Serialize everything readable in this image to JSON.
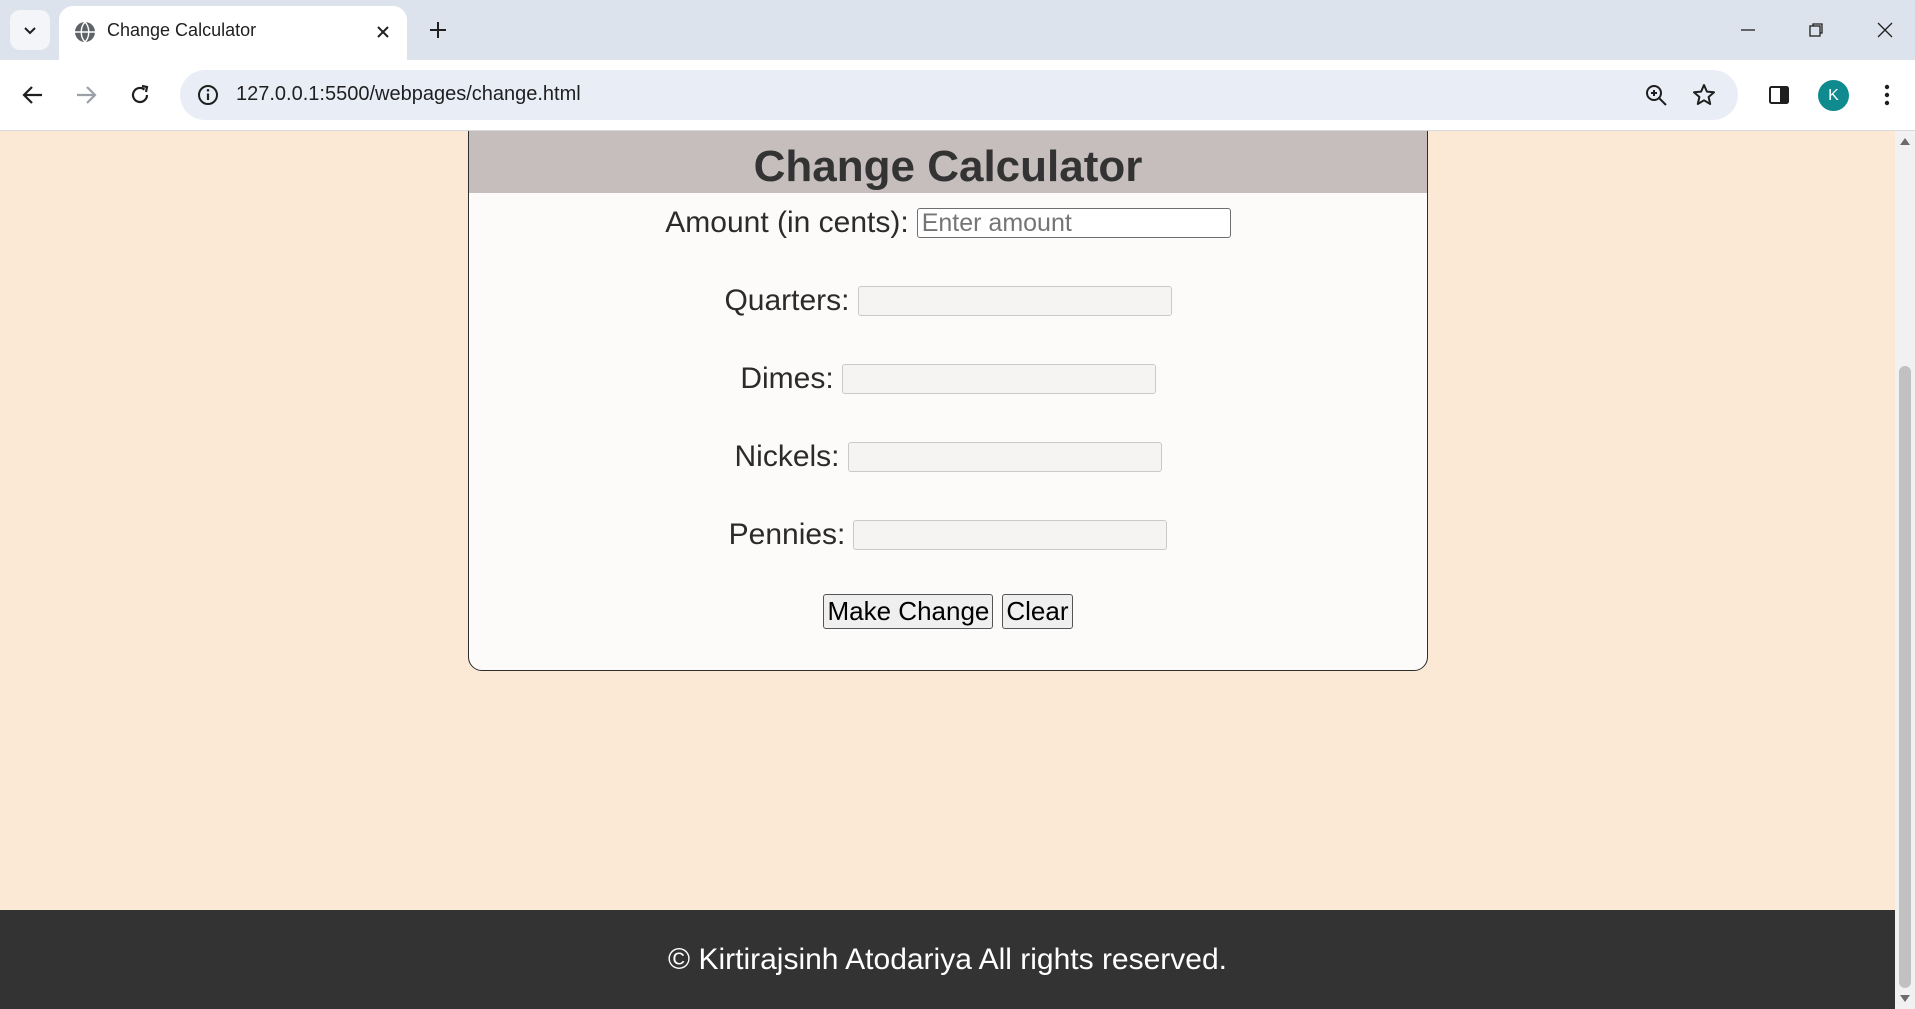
{
  "browser": {
    "tab_title": "Change Calculator",
    "url": "127.0.0.1:5500/webpages/change.html",
    "profile_initial": "K"
  },
  "page": {
    "title": "Change Calculator",
    "amount_label": "Amount (in cents):",
    "amount_placeholder": "Enter amount",
    "amount_value": "",
    "quarters_label": "Quarters:",
    "quarters_value": "",
    "dimes_label": "Dimes:",
    "dimes_value": "",
    "nickels_label": "Nickels:",
    "nickels_value": "",
    "pennies_label": "Pennies:",
    "pennies_value": "",
    "make_change_label": "Make Change",
    "clear_label": "Clear",
    "footer_text": "© Kirtirajsinh Atodariya All rights reserved."
  },
  "colors": {
    "page_background": "#fbe9d6",
    "header_band": "#c5bebd",
    "footer": "#333333",
    "avatar": "#0f8a8f"
  }
}
